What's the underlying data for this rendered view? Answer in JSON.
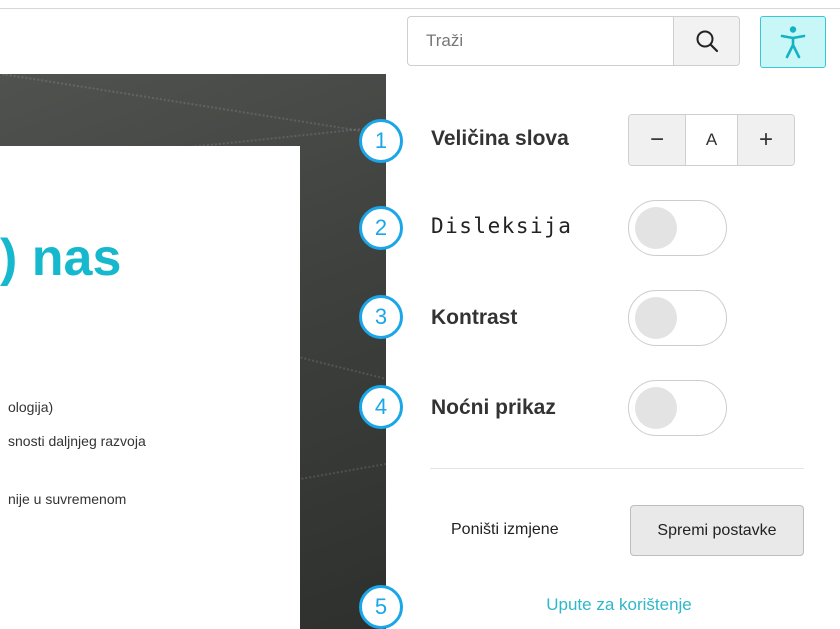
{
  "header": {
    "search": {
      "placeholder": "Traži",
      "icon": "search-icon"
    },
    "accessibility_icon": "accessibility-person-icon",
    "accent_color": "#3cc6d4"
  },
  "background_page": {
    "heading": ") nas",
    "paragraphs": [
      "ologija)",
      "snosti daljnjeg razvoja",
      "nije u suvremenom"
    ],
    "heading_color": "#15b8cc"
  },
  "accessibility_panel": {
    "options": [
      {
        "number": "1",
        "label": "Veličina slova",
        "control": "stepper",
        "decrease": "−",
        "value": "A",
        "increase": "+"
      },
      {
        "number": "2",
        "label": "Disleksija",
        "control": "toggle",
        "enabled": false
      },
      {
        "number": "3",
        "label": "Kontrast",
        "control": "toggle",
        "enabled": false
      },
      {
        "number": "4",
        "label": "Noćni prikaz",
        "control": "toggle",
        "enabled": false
      }
    ],
    "reset_label": "Poništi izmjene",
    "save_label": "Spremi postavke",
    "help": {
      "number": "5",
      "label": "Upute za korištenje"
    },
    "badge_color": "#1aa6e8"
  }
}
